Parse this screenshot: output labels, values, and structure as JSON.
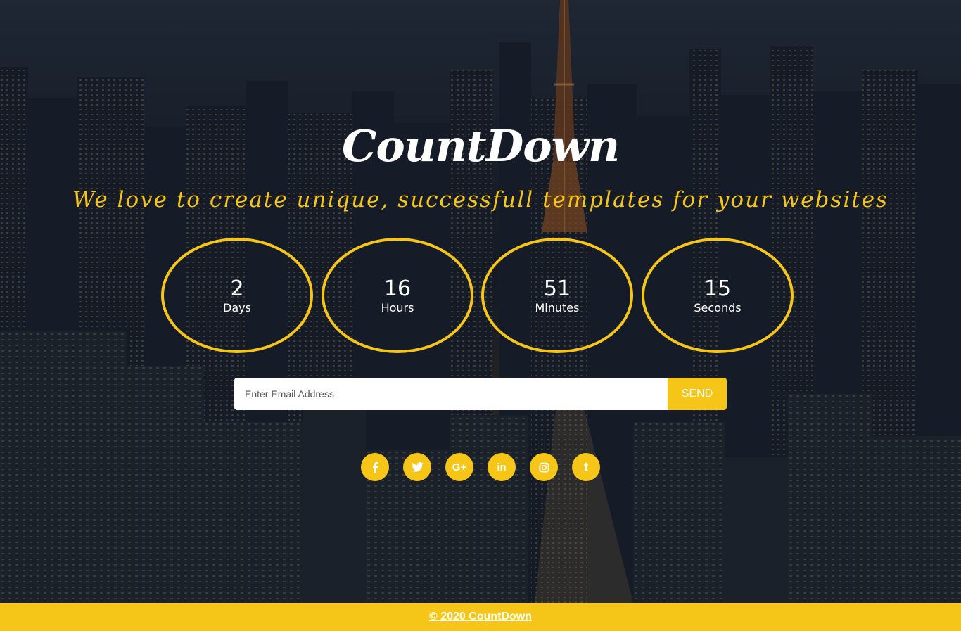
{
  "brand": {
    "title": "CountDown",
    "tagline": "We love to create unique, successfull templates for your websites",
    "accent_color": "#f5c518"
  },
  "countdown": [
    {
      "value": "2",
      "label": "Days"
    },
    {
      "value": "16",
      "label": "Hours"
    },
    {
      "value": "51",
      "label": "Minutes"
    },
    {
      "value": "15",
      "label": "Seconds"
    }
  ],
  "subscribe": {
    "placeholder": "Enter Email Address",
    "button_label": "SEND"
  },
  "social": [
    {
      "icon": "facebook-icon"
    },
    {
      "icon": "twitter-icon"
    },
    {
      "icon": "google-plus-icon",
      "glyph": "G+"
    },
    {
      "icon": "linkedin-icon",
      "glyph": "in"
    },
    {
      "icon": "instagram-icon"
    },
    {
      "icon": "tumblr-icon",
      "glyph": "t"
    }
  ],
  "footer": {
    "copyright": "© 2020 CountDown"
  }
}
